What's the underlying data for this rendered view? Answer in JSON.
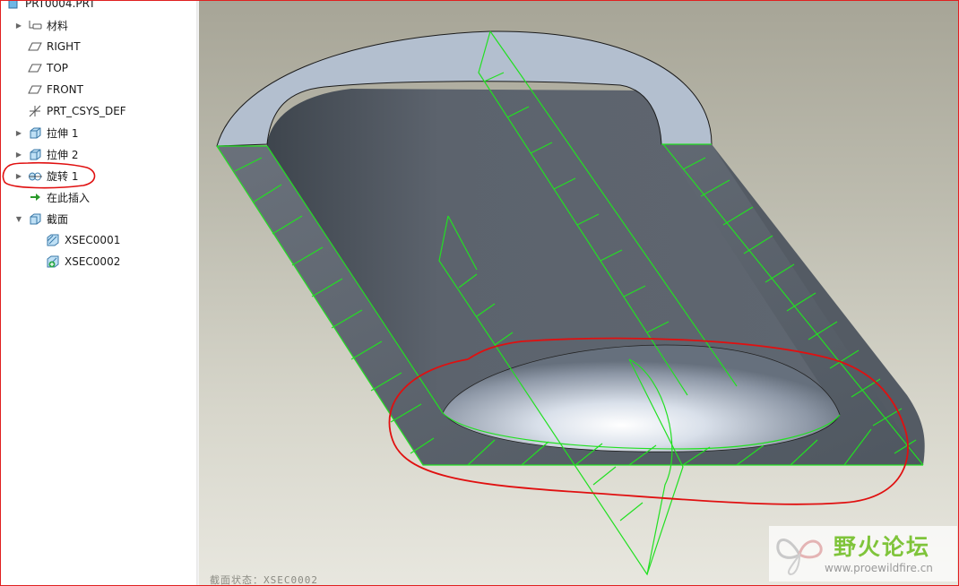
{
  "tree": {
    "root_label": "PRT0004.PRT",
    "items": [
      {
        "label": "材料",
        "icon": "material-icon",
        "expander": "▶"
      },
      {
        "label": "RIGHT",
        "icon": "datum-plane-icon",
        "expander": ""
      },
      {
        "label": "TOP",
        "icon": "datum-plane-icon",
        "expander": ""
      },
      {
        "label": "FRONT",
        "icon": "datum-plane-icon",
        "expander": ""
      },
      {
        "label": "PRT_CSYS_DEF",
        "icon": "coordinate-system-icon",
        "expander": ""
      },
      {
        "label": "拉伸 1",
        "icon": "extrude-icon",
        "expander": "▶"
      },
      {
        "label": "拉伸 2",
        "icon": "extrude-icon",
        "expander": "▶"
      },
      {
        "label": "旋转 1",
        "icon": "revolve-icon",
        "expander": "▶"
      },
      {
        "label": "在此插入",
        "icon": "insert-here-arrow-icon",
        "expander": ""
      },
      {
        "label": "截面",
        "icon": "sections-icon",
        "expander": "▼"
      },
      {
        "label": "XSEC0001",
        "icon": "cross-section-icon",
        "expander": ""
      },
      {
        "label": "XSEC0002",
        "icon": "cross-section-active-icon",
        "expander": ""
      }
    ]
  },
  "viewport": {
    "status_text": "截面状态：XSEC0002"
  },
  "watermark": {
    "title": "野火论坛",
    "url": "www.proewildfire.cn"
  },
  "colors": {
    "annotation_red": "#e01010",
    "section_green": "#22e022",
    "model_gray": "#5a626c",
    "rim_blue": "#b3bfcf"
  }
}
